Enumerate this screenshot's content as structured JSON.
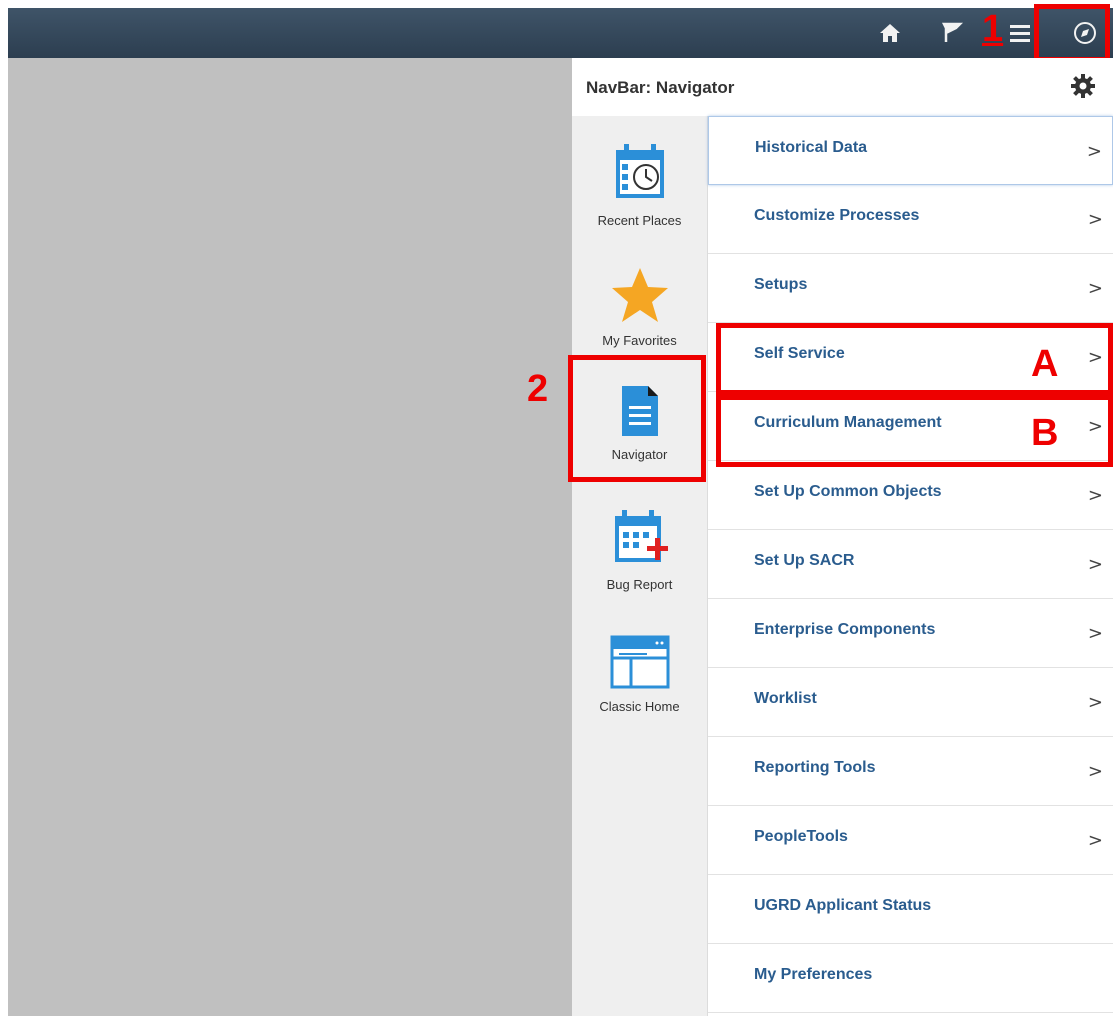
{
  "topbar": {
    "icons": [
      "home-icon",
      "flag-icon",
      "menu-icon",
      "compass-icon"
    ]
  },
  "panel": {
    "title": "NavBar: Navigator"
  },
  "side_items": [
    {
      "label": "Recent Places",
      "icon": "recent-places-icon"
    },
    {
      "label": "My Favorites",
      "icon": "star-icon"
    },
    {
      "label": "Navigator",
      "icon": "navigator-icon"
    },
    {
      "label": "Bug Report",
      "icon": "bug-report-icon"
    },
    {
      "label": "Classic Home",
      "icon": "classic-home-icon"
    }
  ],
  "menu_items": [
    {
      "label": "Historical Data",
      "chevron": ">"
    },
    {
      "label": "Customize Processes",
      "chevron": ">"
    },
    {
      "label": "Setups",
      "chevron": ">"
    },
    {
      "label": "Self Service",
      "chevron": ">"
    },
    {
      "label": "Curriculum Management",
      "chevron": ">"
    },
    {
      "label": "Set Up Common Objects",
      "chevron": ">"
    },
    {
      "label": "Set Up SACR",
      "chevron": ">"
    },
    {
      "label": "Enterprise Components",
      "chevron": ">"
    },
    {
      "label": "Worklist",
      "chevron": ">"
    },
    {
      "label": "Reporting Tools",
      "chevron": ">"
    },
    {
      "label": "PeopleTools",
      "chevron": ">"
    },
    {
      "label": "UGRD Applicant Status",
      "chevron": ""
    },
    {
      "label": "My Preferences",
      "chevron": ""
    }
  ],
  "annotations": {
    "one": "1",
    "two": "2",
    "a": "A",
    "b": "B"
  },
  "colors": {
    "link": "#2a5c8e",
    "annotation": "#ee0000",
    "topbar": "#34495e",
    "star": "#f5a623",
    "icon_blue": "#2b8fd8"
  }
}
